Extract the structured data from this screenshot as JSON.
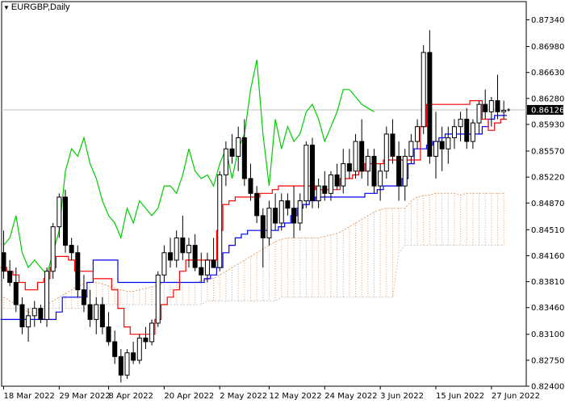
{
  "window": {
    "symbol_label": "EURGBP,Daily",
    "menu_icon": "triangle-down-icon"
  },
  "colors": {
    "background": "#ffffff",
    "axis": "#000000",
    "bull_candle": "#ffffff",
    "bear_candle": "#000000",
    "tenkan": "#ff0000",
    "kijun": "#0000ff",
    "chikou": "#00cc00",
    "cloud": "#e0a070",
    "cloud_b": "#c8c8c8",
    "price_line": "#c0c0c0",
    "price_tag_bg": "#000000"
  },
  "chart_data": {
    "type": "candlestick",
    "instrument": "EURGBP",
    "timeframe": "Daily",
    "current_price": "0.86126",
    "current_price_value": 0.86126,
    "ylim": [
      0.824,
      0.8752
    ],
    "y_ticks": [
      "0.87340",
      "0.86980",
      "0.86630",
      "0.86280",
      "0.85930",
      "0.85570",
      "0.85220",
      "0.84870",
      "0.84510",
      "0.84160",
      "0.83810",
      "0.83460",
      "0.83100",
      "0.82750",
      "0.82400"
    ],
    "x_labels": [
      "18 Mar 2022",
      "29 Mar 2022",
      "8 Apr 2022",
      "20 Apr 2022",
      "2 May 2022",
      "12 May 2022",
      "24 May 2022",
      "3 Jun 2022",
      "15 Jun 2022",
      "27 Jun 2022"
    ],
    "x_label_bar_index": [
      0,
      9,
      17,
      26,
      35,
      43,
      52,
      61,
      70,
      79
    ],
    "bar_count": 82,
    "candles": [
      [
        0.842,
        0.845,
        0.8385,
        0.8395
      ],
      [
        0.8395,
        0.841,
        0.8375,
        0.838
      ],
      [
        0.838,
        0.84,
        0.834,
        0.835
      ],
      [
        0.835,
        0.836,
        0.831,
        0.832
      ],
      [
        0.832,
        0.8345,
        0.83,
        0.8335
      ],
      [
        0.8335,
        0.8355,
        0.832,
        0.8345
      ],
      [
        0.8345,
        0.835,
        0.8325,
        0.833
      ],
      [
        0.833,
        0.84,
        0.832,
        0.8395
      ],
      [
        0.8395,
        0.846,
        0.8385,
        0.8455
      ],
      [
        0.8455,
        0.85,
        0.844,
        0.8495
      ],
      [
        0.8495,
        0.8505,
        0.842,
        0.843
      ],
      [
        0.843,
        0.844,
        0.841,
        0.842
      ],
      [
        0.842,
        0.843,
        0.836,
        0.837
      ],
      [
        0.837,
        0.839,
        0.834,
        0.835
      ],
      [
        0.835,
        0.837,
        0.832,
        0.833
      ],
      [
        0.833,
        0.836,
        0.831,
        0.835
      ],
      [
        0.835,
        0.836,
        0.831,
        0.832
      ],
      [
        0.832,
        0.834,
        0.8295,
        0.83
      ],
      [
        0.83,
        0.8315,
        0.827,
        0.828
      ],
      [
        0.828,
        0.829,
        0.8245,
        0.8255
      ],
      [
        0.8255,
        0.829,
        0.825,
        0.8285
      ],
      [
        0.8285,
        0.83,
        0.827,
        0.8275
      ],
      [
        0.8275,
        0.831,
        0.827,
        0.8305
      ],
      [
        0.8305,
        0.832,
        0.829,
        0.83
      ],
      [
        0.83,
        0.833,
        0.8295,
        0.8325
      ],
      [
        0.8325,
        0.8395,
        0.832,
        0.839
      ],
      [
        0.839,
        0.843,
        0.838,
        0.842
      ],
      [
        0.842,
        0.844,
        0.84,
        0.841
      ],
      [
        0.841,
        0.845,
        0.84,
        0.844
      ],
      [
        0.844,
        0.847,
        0.841,
        0.842
      ],
      [
        0.842,
        0.844,
        0.84,
        0.843
      ],
      [
        0.843,
        0.8445,
        0.8395,
        0.84
      ],
      [
        0.84,
        0.842,
        0.838,
        0.839
      ],
      [
        0.839,
        0.842,
        0.838,
        0.841
      ],
      [
        0.841,
        0.844,
        0.84,
        0.84
      ],
      [
        0.84,
        0.853,
        0.8395,
        0.8525
      ],
      [
        0.8525,
        0.857,
        0.851,
        0.856
      ],
      [
        0.856,
        0.858,
        0.854,
        0.855
      ],
      [
        0.855,
        0.859,
        0.853,
        0.8575
      ],
      [
        0.8575,
        0.86,
        0.851,
        0.852
      ],
      [
        0.852,
        0.854,
        0.849,
        0.85
      ],
      [
        0.85,
        0.851,
        0.846,
        0.847
      ],
      [
        0.847,
        0.848,
        0.84,
        0.844
      ],
      [
        0.844,
        0.849,
        0.843,
        0.848
      ],
      [
        0.848,
        0.85,
        0.845,
        0.846
      ],
      [
        0.846,
        0.85,
        0.845,
        0.849
      ],
      [
        0.849,
        0.85,
        0.847,
        0.848
      ],
      [
        0.848,
        0.851,
        0.844,
        0.846
      ],
      [
        0.846,
        0.85,
        0.845,
        0.849
      ],
      [
        0.849,
        0.857,
        0.848,
        0.8565
      ],
      [
        0.8565,
        0.8575,
        0.848,
        0.849
      ],
      [
        0.849,
        0.852,
        0.848,
        0.851
      ],
      [
        0.851,
        0.853,
        0.849,
        0.85
      ],
      [
        0.85,
        0.853,
        0.849,
        0.8525
      ],
      [
        0.8525,
        0.854,
        0.8505,
        0.851
      ],
      [
        0.851,
        0.856,
        0.85,
        0.854
      ],
      [
        0.854,
        0.856,
        0.852,
        0.853
      ],
      [
        0.853,
        0.858,
        0.852,
        0.857
      ],
      [
        0.857,
        0.86,
        0.852,
        0.853
      ],
      [
        0.853,
        0.856,
        0.851,
        0.855
      ],
      [
        0.855,
        0.856,
        0.85,
        0.851
      ],
      [
        0.851,
        0.854,
        0.849,
        0.853
      ],
      [
        0.853,
        0.859,
        0.852,
        0.858
      ],
      [
        0.858,
        0.86,
        0.854,
        0.855
      ],
      [
        0.855,
        0.857,
        0.849,
        0.851
      ],
      [
        0.851,
        0.856,
        0.849,
        0.855
      ],
      [
        0.855,
        0.858,
        0.854,
        0.857
      ],
      [
        0.857,
        0.86,
        0.856,
        0.859
      ],
      [
        0.859,
        0.87,
        0.858,
        0.869
      ],
      [
        0.869,
        0.872,
        0.854,
        0.855
      ],
      [
        0.855,
        0.861,
        0.852,
        0.857
      ],
      [
        0.857,
        0.859,
        0.853,
        0.856
      ],
      [
        0.856,
        0.859,
        0.854,
        0.8575
      ],
      [
        0.8575,
        0.86,
        0.856,
        0.859
      ],
      [
        0.859,
        0.861,
        0.857,
        0.86
      ],
      [
        0.86,
        0.8615,
        0.856,
        0.857
      ],
      [
        0.857,
        0.86,
        0.856,
        0.8595
      ],
      [
        0.8595,
        0.8625,
        0.858,
        0.862
      ],
      [
        0.862,
        0.864,
        0.86,
        0.861
      ],
      [
        0.861,
        0.863,
        0.859,
        0.8625
      ],
      [
        0.8625,
        0.866,
        0.86,
        0.861
      ],
      [
        0.861,
        0.8625,
        0.86,
        0.8612
      ]
    ],
    "tenkan_sen": [
      0.84,
      0.8395,
      0.839,
      0.838,
      0.837,
      0.837,
      0.838,
      0.8385,
      0.84,
      0.8415,
      0.8415,
      0.841,
      0.8395,
      0.8395,
      0.8395,
      0.8385,
      0.8385,
      0.8385,
      0.837,
      0.8345,
      0.832,
      0.831,
      0.831,
      0.831,
      0.831,
      0.833,
      0.835,
      0.836,
      0.837,
      0.8395,
      0.841,
      0.841,
      0.841,
      0.841,
      0.841,
      0.845,
      0.8485,
      0.849,
      0.8495,
      0.8495,
      0.8495,
      0.8495,
      0.85,
      0.85,
      0.8505,
      0.851,
      0.851,
      0.851,
      0.851,
      0.851,
      0.851,
      0.8505,
      0.8505,
      0.8505,
      0.8505,
      0.852,
      0.852,
      0.8525,
      0.853,
      0.854,
      0.854,
      0.854,
      0.8545,
      0.8545,
      0.8545,
      0.8545,
      0.8545,
      0.8545,
      0.859,
      0.862,
      0.862,
      0.862,
      0.862,
      0.862,
      0.862,
      0.862,
      0.8625,
      0.8625,
      0.86,
      0.8585,
      0.8595,
      0.86
    ],
    "kijun_sen": [
      0.833,
      0.833,
      0.833,
      0.833,
      0.833,
      0.833,
      0.833,
      0.833,
      0.833,
      0.834,
      0.836,
      0.836,
      0.836,
      0.836,
      0.838,
      0.841,
      0.841,
      0.841,
      0.841,
      0.838,
      0.838,
      0.838,
      0.838,
      0.838,
      0.838,
      0.838,
      0.838,
      0.838,
      0.838,
      0.838,
      0.838,
      0.838,
      0.838,
      0.8385,
      0.839,
      0.84,
      0.842,
      0.843,
      0.844,
      0.8445,
      0.845,
      0.845,
      0.845,
      0.845,
      0.845,
      0.8455,
      0.846,
      0.847,
      0.848,
      0.8485,
      0.849,
      0.8495,
      0.8495,
      0.8495,
      0.8495,
      0.8495,
      0.8495,
      0.8495,
      0.8495,
      0.85,
      0.85,
      0.8505,
      0.851,
      0.851,
      0.851,
      0.852,
      0.854,
      0.856,
      0.856,
      0.8565,
      0.857,
      0.8575,
      0.858,
      0.858,
      0.858,
      0.858,
      0.858,
      0.858,
      0.859,
      0.86,
      0.8605,
      0.8605
    ],
    "chikou_span": [
      0.843,
      0.844,
      0.847,
      0.842,
      0.84,
      0.841,
      0.84,
      0.839,
      0.842,
      0.845,
      0.853,
      0.856,
      0.855,
      0.8575,
      0.854,
      0.852,
      0.849,
      0.847,
      0.846,
      0.844,
      0.848,
      0.846,
      0.849,
      0.848,
      0.847,
      0.848,
      0.851,
      0.851,
      0.85,
      0.8525,
      0.856,
      0.853,
      0.852,
      0.8525,
      0.851,
      0.854,
      0.856,
      0.852,
      0.856,
      0.858,
      0.864,
      0.868,
      0.858,
      0.851,
      0.86,
      0.856,
      0.859,
      0.857,
      0.858,
      0.861,
      0.862,
      0.86,
      0.857,
      0.859,
      0.861,
      0.864,
      0.864,
      0.863,
      0.862,
      0.8615,
      0.861
    ],
    "cloud_span_a": [
      0.836,
      0.8355,
      0.835,
      0.8345,
      0.834,
      0.834,
      0.8345,
      0.835,
      0.8355,
      0.836,
      0.8365,
      0.837,
      0.8375,
      0.8378,
      0.838,
      0.838,
      0.8378,
      0.8375,
      0.8372,
      0.837,
      0.8368,
      0.8368,
      0.837,
      0.8372,
      0.8374,
      0.8376,
      0.838,
      0.838,
      0.838,
      0.838,
      0.838,
      0.838,
      0.8382,
      0.8384,
      0.8386,
      0.839,
      0.8395,
      0.84,
      0.8405,
      0.841,
      0.8415,
      0.842,
      0.8425,
      0.843,
      0.8435,
      0.8438,
      0.844,
      0.844,
      0.844,
      0.844,
      0.844,
      0.844,
      0.8442,
      0.8444,
      0.8446,
      0.845,
      0.8455,
      0.846,
      0.8465,
      0.847,
      0.8475,
      0.8478,
      0.848,
      0.848,
      0.848,
      0.848,
      0.849,
      0.8495,
      0.8497,
      0.8498,
      0.85,
      0.85,
      0.85,
      0.85,
      0.8498,
      0.85,
      0.85,
      0.85,
      0.85,
      0.85,
      0.85,
      0.85
    ],
    "cloud_span_b": [
      0.8345,
      0.8345,
      0.8345,
      0.8345,
      0.8345,
      0.8345,
      0.8345,
      0.8345,
      0.8345,
      0.8345,
      0.8345,
      0.8345,
      0.8345,
      0.8345,
      0.8345,
      0.835,
      0.835,
      0.835,
      0.835,
      0.835,
      0.835,
      0.835,
      0.835,
      0.835,
      0.835,
      0.835,
      0.835,
      0.835,
      0.835,
      0.835,
      0.835,
      0.835,
      0.835,
      0.8355,
      0.8355,
      0.8355,
      0.8355,
      0.8355,
      0.8355,
      0.8355,
      0.8355,
      0.8355,
      0.8355,
      0.8355,
      0.8355,
      0.836,
      0.836,
      0.836,
      0.836,
      0.836,
      0.836,
      0.836,
      0.836,
      0.836,
      0.836,
      0.836,
      0.836,
      0.836,
      0.836,
      0.836,
      0.836,
      0.836,
      0.836,
      0.836,
      0.842,
      0.843,
      0.843,
      0.843,
      0.843,
      0.843,
      0.843,
      0.843,
      0.843,
      0.843,
      0.843,
      0.843,
      0.843,
      0.843,
      0.843,
      0.843,
      0.843,
      0.843
    ],
    "grid": false,
    "legend": "none"
  }
}
